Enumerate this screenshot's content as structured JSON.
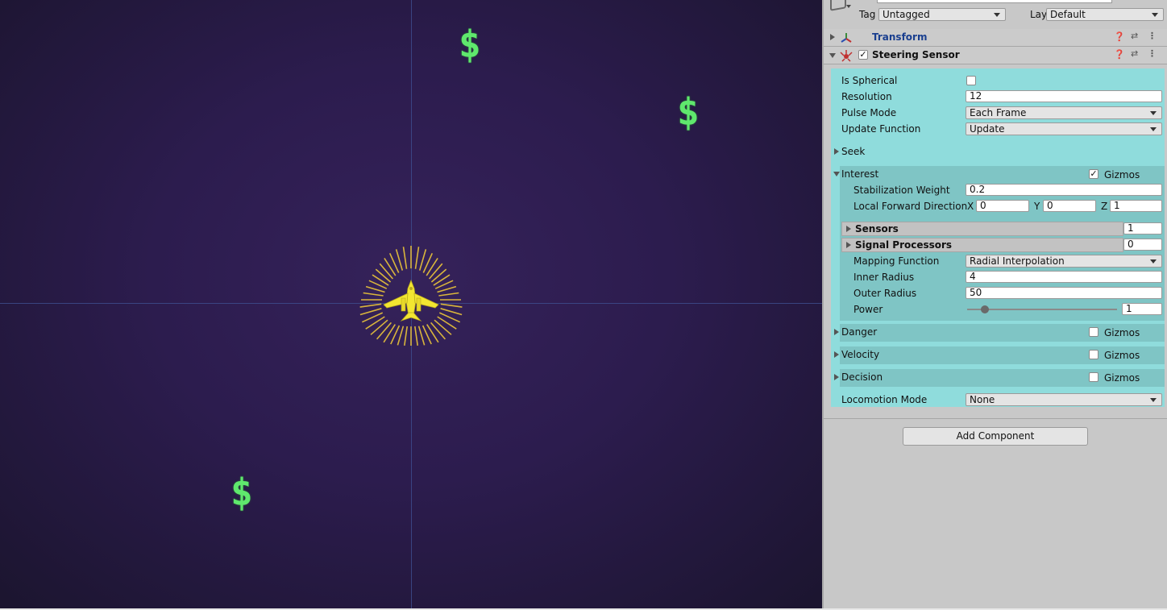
{
  "colors": {
    "coin": "#5fe86d",
    "sensor_rays": "#d9b53c",
    "ship": "#f2e631",
    "scene_bg": "#2c1c4e",
    "highlight": "#8fdcdc",
    "transform_label": "#1a3f8f"
  },
  "scene": {
    "coin_glyph": "$"
  },
  "inspector": {
    "tag_label": "Tag",
    "tag_value": "Untagged",
    "layer_label": "Layer",
    "layer_value": "Default",
    "transform": {
      "title": "Transform"
    },
    "steering_sensor": {
      "title": "Steering Sensor",
      "enabled": true,
      "is_spherical_label": "Is Spherical",
      "is_spherical": false,
      "resolution_label": "Resolution",
      "resolution": "12",
      "pulse_mode_label": "Pulse Mode",
      "pulse_mode": "Each Frame",
      "update_function_label": "Update Function",
      "update_function": "Update",
      "seek_label": "Seek",
      "interest": {
        "label": "Interest",
        "gizmos_label": "Gizmos",
        "gizmos": true,
        "stabilization_weight_label": "Stabilization Weight",
        "stabilization_weight": "0.2",
        "local_forward_label": "Local Forward Direction",
        "x_label": "X",
        "x": "0",
        "y_label": "Y",
        "y": "0",
        "z_label": "Z",
        "z": "1",
        "sensors_label": "Sensors",
        "sensors_count": "1",
        "signal_processors_label": "Signal Processors",
        "signal_processors_count": "0",
        "mapping_function_label": "Mapping Function",
        "mapping_function": "Radial Interpolation",
        "inner_radius_label": "Inner Radius",
        "inner_radius": "4",
        "outer_radius_label": "Outer Radius",
        "outer_radius": "50",
        "power_label": "Power",
        "power": "1",
        "power_slider_fraction": 0.12
      },
      "danger": {
        "label": "Danger",
        "gizmos_label": "Gizmos",
        "gizmos": false
      },
      "velocity": {
        "label": "Velocity",
        "gizmos_label": "Gizmos",
        "gizmos": false
      },
      "decision": {
        "label": "Decision",
        "gizmos_label": "Gizmos",
        "gizmos": false
      },
      "locomotion_mode_label": "Locomotion Mode",
      "locomotion_mode": "None"
    },
    "add_component_label": "Add Component"
  }
}
